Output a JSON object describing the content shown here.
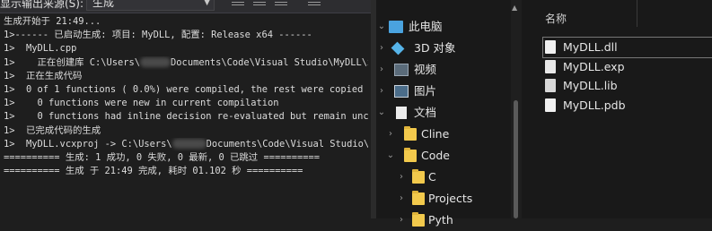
{
  "vs": {
    "toolbar": {
      "source_label": "显示输出来源(S):",
      "source_value": "生成"
    },
    "output_lines": [
      "生成开始于 21:49...",
      "1>------ 已启动生成: 项目: MyDLL, 配置: Release x64 ------",
      "1>  MyDLL.cpp",
      "1>    正在创建库 C:\\Users\\",
      "1>  正在生成代码",
      "1>  0 of 1 functions ( 0.0%) were compiled, the rest were copied from",
      "1>    0 functions were new in current compilation",
      "1>    0 functions had inline decision re-evaluated but remain unchanged",
      "1>  已完成代码的生成",
      "1>  MyDLL.vcxproj -> C:\\Users\\",
      "========== 生成: 1 成功, 0 失败, 0 最新, 0 已跳过 ==========",
      "========== 生成 于 21:49 完成, 耗时 01.102 秒 =========="
    ],
    "line4_tail": "Documents\\Code\\Visual Studio\\MyDLL\\x",
    "line10_tail": "Documents\\Code\\Visual Studio\\MyD"
  },
  "explorer": {
    "nav": [
      {
        "label": "此电脑",
        "icon": "pc-icon"
      },
      {
        "label": "3D 对象",
        "icon": "cube-icon"
      },
      {
        "label": "视频",
        "icon": "video-icon"
      },
      {
        "label": "图片",
        "icon": "picture-icon"
      },
      {
        "label": "文档",
        "icon": "document-icon"
      },
      {
        "label": "Cline",
        "icon": "folder-icon"
      },
      {
        "label": "Code",
        "icon": "folder-icon"
      },
      {
        "label": "C",
        "icon": "folder-icon"
      },
      {
        "label": "Projects",
        "icon": "folder-icon"
      },
      {
        "label": "Pyth",
        "icon": "folder-icon"
      }
    ],
    "column_name": "名称",
    "files": [
      {
        "name": "MyDLL.dll",
        "icon": "dll-file-icon"
      },
      {
        "name": "MyDLL.exp",
        "icon": "exp-file-icon"
      },
      {
        "name": "MyDLL.lib",
        "icon": "lib-file-icon"
      },
      {
        "name": "MyDLL.pdb",
        "icon": "pdb-file-icon"
      }
    ]
  }
}
